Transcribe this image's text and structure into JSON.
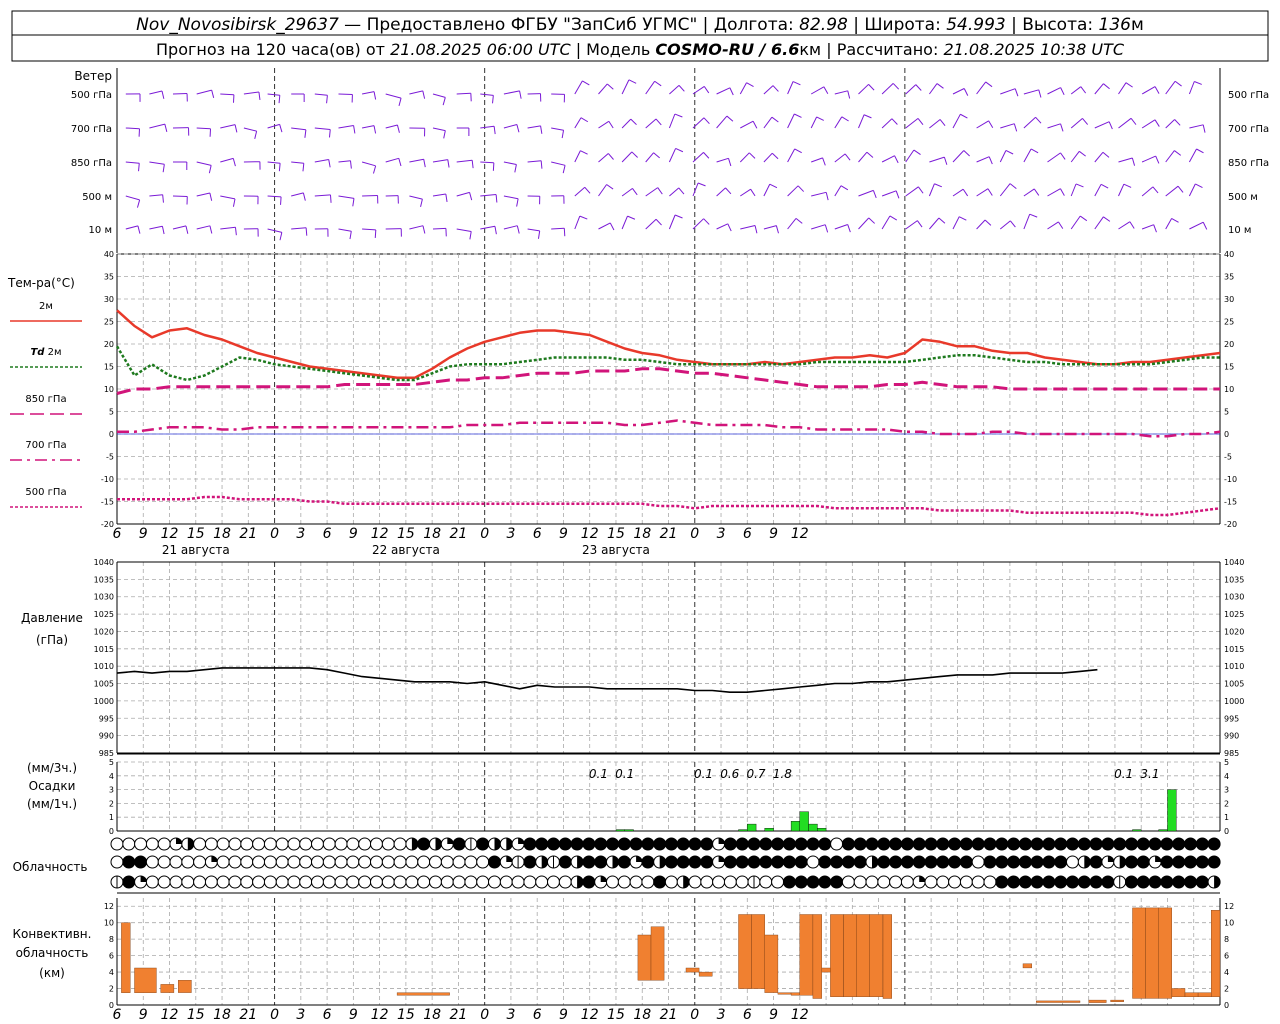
{
  "header": {
    "line1": [
      {
        "t": "Nov_Novosibirsk_29637",
        "i": true
      },
      {
        "t": " — Предоставлено ФГБУ \"ЗапСиб УГМС\" | Долгота: ",
        "i": false
      },
      {
        "t": "82.98",
        "i": true
      },
      {
        "t": " | Широта: ",
        "i": false
      },
      {
        "t": "54.993",
        "i": true
      },
      {
        "t": " | Высота: ",
        "i": false
      },
      {
        "t": "136",
        "i": true
      },
      {
        "t": "м",
        "i": false
      }
    ],
    "line2": [
      {
        "t": "Прогноз на 120 часа(ов) от ",
        "i": false
      },
      {
        "t": "21.08.2025 06:00 UTC",
        "i": true
      },
      {
        "t": "  | Модель ",
        "i": false
      },
      {
        "t": "COSMO-RU / 6.6",
        "i": true,
        "b": true
      },
      {
        "t": "км | Рассчитано: ",
        "i": false
      },
      {
        "t": "21.08.2025 10:38 UTC",
        "i": true
      }
    ]
  },
  "time_axis": {
    "start_hour": 6,
    "hours": 126,
    "tick_labels": [
      "6",
      "9",
      "12",
      "15",
      "18",
      "21",
      "0",
      "3",
      "6",
      "9",
      "12",
      "15",
      "18",
      "21",
      "0",
      "3",
      "6",
      "9",
      "12",
      "15",
      "18",
      "21",
      "0",
      "3",
      "6",
      "9",
      "12"
    ],
    "midnight_offsets": [
      18,
      42,
      66,
      90
    ],
    "day_labels": [
      {
        "text": "21 августа",
        "offset": 9
      },
      {
        "text": "22 августа",
        "offset": 33
      },
      {
        "text": "23 августа",
        "offset": 57
      }
    ]
  },
  "wind_panel": {
    "title": "Ветер",
    "levels": [
      "500 гПа",
      "700 гПа",
      "850 гПа",
      "500 м",
      "10  м"
    ],
    "color": "#7a1ad6"
  },
  "chart_data": [
    {
      "type": "line",
      "id": "temperature",
      "title": "Тем-ра(°С)",
      "ylim": [
        -20,
        40
      ],
      "yticks": [
        -20,
        -15,
        -10,
        -5,
        0,
        5,
        10,
        15,
        20,
        25,
        30,
        35,
        40
      ],
      "x": [
        0,
        2,
        4,
        6,
        8,
        10,
        12,
        14,
        16,
        18,
        20,
        22,
        24,
        26,
        28,
        30,
        32,
        34,
        36,
        38,
        40,
        42,
        44,
        46,
        48,
        50,
        52,
        54,
        56,
        58,
        60,
        62,
        64,
        66,
        68,
        70,
        72,
        74,
        76,
        78,
        80,
        82,
        84,
        86,
        88,
        90,
        92,
        94,
        96,
        98,
        100,
        102,
        104,
        106,
        108,
        110,
        112,
        114,
        116,
        118,
        120,
        122,
        124,
        126
      ],
      "series": [
        {
          "name": "2м",
          "color": "#e8392a",
          "style": "solid",
          "width": 2.5,
          "values": [
            27.5,
            24,
            21.5,
            23,
            23.5,
            22,
            21,
            19.5,
            18,
            17,
            16,
            15,
            14.5,
            14,
            13.5,
            13,
            12.5,
            12.5,
            14.5,
            17,
            19,
            20.5,
            21.5,
            22.5,
            23,
            23,
            22.5,
            22,
            20.5,
            19,
            18,
            17.5,
            16.5,
            16,
            15.5,
            15.5,
            15.5,
            16,
            15.5,
            16,
            16.5,
            17,
            17,
            17.5,
            17,
            18,
            21,
            20.5,
            19.5,
            19.5,
            18.5,
            18,
            18,
            17,
            16.5,
            16,
            15.5,
            15.5,
            16,
            16,
            16.5,
            17,
            17.5,
            18,
            19,
            18.5,
            18.5,
            18
          ]
        },
        {
          "name": "Td 2м",
          "color": "#1e7a1e",
          "style": "dot",
          "width": 2.5,
          "values": [
            19.5,
            13,
            15.5,
            13,
            12,
            13,
            15,
            17,
            16.5,
            15.5,
            15,
            14.5,
            14,
            13.5,
            13,
            12.5,
            12,
            12,
            13.5,
            15,
            15.5,
            15.5,
            15.5,
            16,
            16.5,
            17,
            17,
            17,
            17,
            16.5,
            16.5,
            16,
            15.5,
            15.5,
            15.5,
            15.5,
            15.5,
            15.5,
            15.5,
            15.5,
            16,
            16,
            16,
            16,
            16,
            16,
            16.5,
            17,
            17.5,
            17.5,
            17,
            16.5,
            16,
            16,
            15.5,
            15.5,
            15.5,
            15.5,
            15.5,
            15.5,
            16,
            16.5,
            17,
            17,
            17.5,
            17.5,
            17,
            17,
            16.5
          ]
        },
        {
          "name": "850 гПа",
          "color": "#d1147a",
          "style": "dash",
          "width": 3,
          "values": [
            9,
            10,
            10,
            10.5,
            10.5,
            10.5,
            10.5,
            10.5,
            10.5,
            10.5,
            10.5,
            10.5,
            10.5,
            11,
            11,
            11,
            11,
            11,
            11.5,
            12,
            12,
            12.5,
            12.5,
            13,
            13.5,
            13.5,
            13.5,
            14,
            14,
            14,
            14.5,
            14.5,
            14,
            13.5,
            13.5,
            13,
            12.5,
            12,
            11.5,
            11,
            10.5,
            10.5,
            10.5,
            10.5,
            11,
            11,
            11.5,
            11,
            10.5,
            10.5,
            10.5,
            10,
            10,
            10,
            10,
            10,
            10,
            10,
            10,
            10,
            10,
            10,
            10,
            10,
            10,
            10,
            10.5,
            10.5,
            11
          ]
        },
        {
          "name": "700 гПа",
          "color": "#d1147a",
          "style": "dashdot",
          "width": 2.5,
          "values": [
            0.5,
            0.5,
            1,
            1.5,
            1.5,
            1.5,
            1,
            1,
            1.5,
            1.5,
            1.5,
            1.5,
            1.5,
            1.5,
            1.5,
            1.5,
            1.5,
            1.5,
            1.5,
            1.5,
            2,
            2,
            2,
            2.5,
            2.5,
            2.5,
            2.5,
            2.5,
            2.5,
            2,
            2,
            2.5,
            3,
            2.5,
            2,
            2,
            2,
            2,
            1.5,
            1.5,
            1,
            1,
            1,
            1,
            1,
            0.5,
            0.5,
            0,
            0,
            0,
            0.5,
            0.5,
            0,
            0,
            0,
            0,
            0,
            0,
            0,
            -0.5,
            -0.5,
            0,
            0,
            0.5,
            1,
            1.5,
            1.5,
            1,
            1
          ]
        },
        {
          "name": "500 гПа",
          "color": "#d1147a",
          "style": "dot",
          "width": 2.5,
          "values": [
            -14.5,
            -14.5,
            -14.5,
            -14.5,
            -14.5,
            -14,
            -14,
            -14.5,
            -14.5,
            -14.5,
            -14.5,
            -15,
            -15,
            -15.5,
            -15.5,
            -15.5,
            -15.5,
            -15.5,
            -15.5,
            -15.5,
            -15.5,
            -15.5,
            -15.5,
            -15.5,
            -15.5,
            -15.5,
            -15.5,
            -15.5,
            -15.5,
            -15.5,
            -15.5,
            -16,
            -16,
            -16.5,
            -16,
            -16,
            -16,
            -16,
            -16,
            -16,
            -16,
            -16.5,
            -16.5,
            -16.5,
            -16.5,
            -16.5,
            -16.5,
            -17,
            -17,
            -17,
            -17,
            -17,
            -17.5,
            -17.5,
            -17.5,
            -17.5,
            -17.5,
            -17.5,
            -17.5,
            -18,
            -18,
            -17.5,
            -17,
            -16.5,
            -16,
            -15.5,
            -15,
            -14.5,
            -14
          ]
        }
      ]
    },
    {
      "type": "line",
      "id": "pressure",
      "title": "Давление",
      "subtitle": "(гПа)",
      "ylim": [
        985,
        1040
      ],
      "yticks": [
        985,
        990,
        995,
        1000,
        1005,
        1010,
        1015,
        1020,
        1025,
        1030,
        1035,
        1040
      ],
      "x": [
        0,
        2,
        4,
        6,
        8,
        10,
        12,
        14,
        16,
        18,
        20,
        22,
        24,
        26,
        28,
        30,
        32,
        34,
        36,
        38,
        40,
        42,
        44,
        46,
        48,
        50,
        52,
        54,
        56,
        58,
        60,
        62,
        64,
        66,
        68,
        70,
        72,
        74,
        76,
        78,
        80,
        82,
        84,
        86,
        88,
        90,
        92,
        94,
        96,
        98,
        100,
        102,
        104,
        106,
        108,
        110,
        112,
        114,
        116,
        118,
        120,
        122,
        124,
        126
      ],
      "series": [
        {
          "name": "",
          "color": "#000000",
          "style": "solid",
          "width": 1.6,
          "values": [
            1008,
            1008.5,
            1008,
            1008.5,
            1008.5,
            1009,
            1009.5,
            1009.5,
            1009.5,
            1009.5,
            1009.5,
            1009.5,
            1009,
            1008,
            1007,
            1006.5,
            1006,
            1005.5,
            1005.5,
            1005.5,
            1005,
            1005.5,
            1004.5,
            1003.5,
            1004.5,
            1004,
            1004,
            1004,
            1003.5,
            1003.5,
            1003.5,
            1003.5,
            1003.5,
            1003,
            1003,
            1002.5,
            1002.5,
            1003,
            1003.5,
            1004,
            1004.5,
            1005,
            1005,
            1005.5,
            1005.5,
            1006,
            1006.5,
            1007,
            1007.5,
            1007.5,
            1007.5,
            1008,
            1008,
            1008,
            1008,
            1008.5,
            1009
          ]
        }
      ]
    },
    {
      "type": "bar",
      "id": "precipitation",
      "title": "(мм/3ч.)",
      "subtitle": "Осадки",
      "subtitle2": "(мм/1ч.)",
      "ylim": [
        0,
        5
      ],
      "yticks": [
        0,
        1,
        2,
        3,
        4,
        5
      ],
      "color": "#22dd22",
      "bars": [
        {
          "x": 57.5,
          "v": 0.1
        },
        {
          "x": 58.5,
          "v": 0.1
        },
        {
          "x": 71.5,
          "v": 0.1
        },
        {
          "x": 72.5,
          "v": 0.5
        },
        {
          "x": 74.5,
          "v": 0.2
        },
        {
          "x": 77.5,
          "v": 0.7
        },
        {
          "x": 78.5,
          "v": 1.4
        },
        {
          "x": 79.5,
          "v": 0.5
        },
        {
          "x": 80.5,
          "v": 0.2
        },
        {
          "x": 116.5,
          "v": 0.1
        },
        {
          "x": 119.5,
          "v": 0.1
        },
        {
          "x": 120.5,
          "v": 3.0
        }
      ],
      "labels": [
        {
          "x": 55,
          "text": "0.1"
        },
        {
          "x": 58,
          "text": "0.1"
        },
        {
          "x": 67,
          "text": "0.1"
        },
        {
          "x": 70,
          "text": "0.6"
        },
        {
          "x": 73,
          "text": "0.7"
        },
        {
          "x": 76,
          "text": "1.8"
        },
        {
          "x": 115,
          "text": "0.1"
        },
        {
          "x": 118,
          "text": "3.1"
        }
      ]
    },
    {
      "type": "bar",
      "id": "convective",
      "title": "Конвективн.",
      "subtitle": "облачность",
      "subtitle2": "(км)",
      "ylim": [
        0,
        13
      ],
      "yticks": [
        0,
        2,
        4,
        6,
        8,
        10,
        12
      ],
      "color": "#f08030",
      "bars": [
        {
          "x0": 0.5,
          "x1": 1.5,
          "lo": 1.5,
          "hi": 10
        },
        {
          "x0": 2,
          "x1": 4.5,
          "lo": 1.5,
          "hi": 4.5
        },
        {
          "x0": 5,
          "x1": 6.5,
          "lo": 1.5,
          "hi": 2.5
        },
        {
          "x0": 7,
          "x1": 8.5,
          "lo": 1.5,
          "hi": 3
        },
        {
          "x0": 32,
          "x1": 38,
          "lo": 1.2,
          "hi": 1.5
        },
        {
          "x0": 59.5,
          "x1": 61,
          "lo": 3,
          "hi": 8.5
        },
        {
          "x0": 61,
          "x1": 62.5,
          "lo": 3,
          "hi": 9.5
        },
        {
          "x0": 65,
          "x1": 66.5,
          "lo": 4,
          "hi": 4.5
        },
        {
          "x0": 66.5,
          "x1": 68,
          "lo": 3.5,
          "hi": 4
        },
        {
          "x0": 71,
          "x1": 72.5,
          "lo": 2,
          "hi": 11
        },
        {
          "x0": 72.5,
          "x1": 74,
          "lo": 2,
          "hi": 11
        },
        {
          "x0": 74,
          "x1": 75.5,
          "lo": 1.5,
          "hi": 8.5
        },
        {
          "x0": 75.5,
          "x1": 77,
          "lo": 1.5,
          "hi": 1.5
        },
        {
          "x0": 77,
          "x1": 78,
          "lo": 1.2,
          "hi": 1.5
        },
        {
          "x0": 78,
          "x1": 79.5,
          "lo": 1.2,
          "hi": 11
        },
        {
          "x0": 79.5,
          "x1": 80.5,
          "lo": 0.8,
          "hi": 11
        },
        {
          "x0": 80.5,
          "x1": 81.5,
          "lo": 4,
          "hi": 4.5
        },
        {
          "x0": 81.5,
          "x1": 83,
          "lo": 1,
          "hi": 11
        },
        {
          "x0": 83,
          "x1": 84.5,
          "lo": 1,
          "hi": 11
        },
        {
          "x0": 84.5,
          "x1": 86,
          "lo": 1,
          "hi": 11
        },
        {
          "x0": 86,
          "x1": 87.5,
          "lo": 1,
          "hi": 11
        },
        {
          "x0": 87.5,
          "x1": 88.5,
          "lo": 0.8,
          "hi": 11
        },
        {
          "x0": 103.5,
          "x1": 104.5,
          "lo": 4.5,
          "hi": 5
        },
        {
          "x0": 105,
          "x1": 110,
          "lo": 0.3,
          "hi": 0.5
        },
        {
          "x0": 111,
          "x1": 113,
          "lo": 0.3,
          "hi": 0.6
        },
        {
          "x0": 113.5,
          "x1": 115,
          "lo": 0.4,
          "hi": 0.6
        },
        {
          "x0": 116,
          "x1": 117.5,
          "lo": 0.8,
          "hi": 11.8
        },
        {
          "x0": 117.5,
          "x1": 119,
          "lo": 0.8,
          "hi": 11.8
        },
        {
          "x0": 119,
          "x1": 120.5,
          "lo": 0.8,
          "hi": 11.8
        },
        {
          "x0": 120.5,
          "x1": 122,
          "lo": 1,
          "hi": 2
        },
        {
          "x0": 122,
          "x1": 123.5,
          "lo": 1,
          "hi": 1.5
        },
        {
          "x0": 123.5,
          "x1": 125,
          "lo": 1,
          "hi": 1.5
        },
        {
          "x0": 125,
          "x1": 126,
          "lo": 1,
          "hi": 11.5
        }
      ]
    }
  ],
  "cloudiness": {
    "title": "Облачность",
    "rows": [
      "ooooobqooooooooooooooooooqfqbfnfqqbffffffffffffffffbfffffffffoffffffffffffffffffffffffffffffff",
      "offooooobooooooooooooooooooooooofbnfqnfqffqfbfqffffbfffffffoffffqffffffffofffffffoqfbqffbfffff",
      "nfbooooooooooooooooooooooooooooooooooooqfboooofoqooooonoofffffoooooobooooooffffffffffnfffffffqfq"
    ]
  }
}
